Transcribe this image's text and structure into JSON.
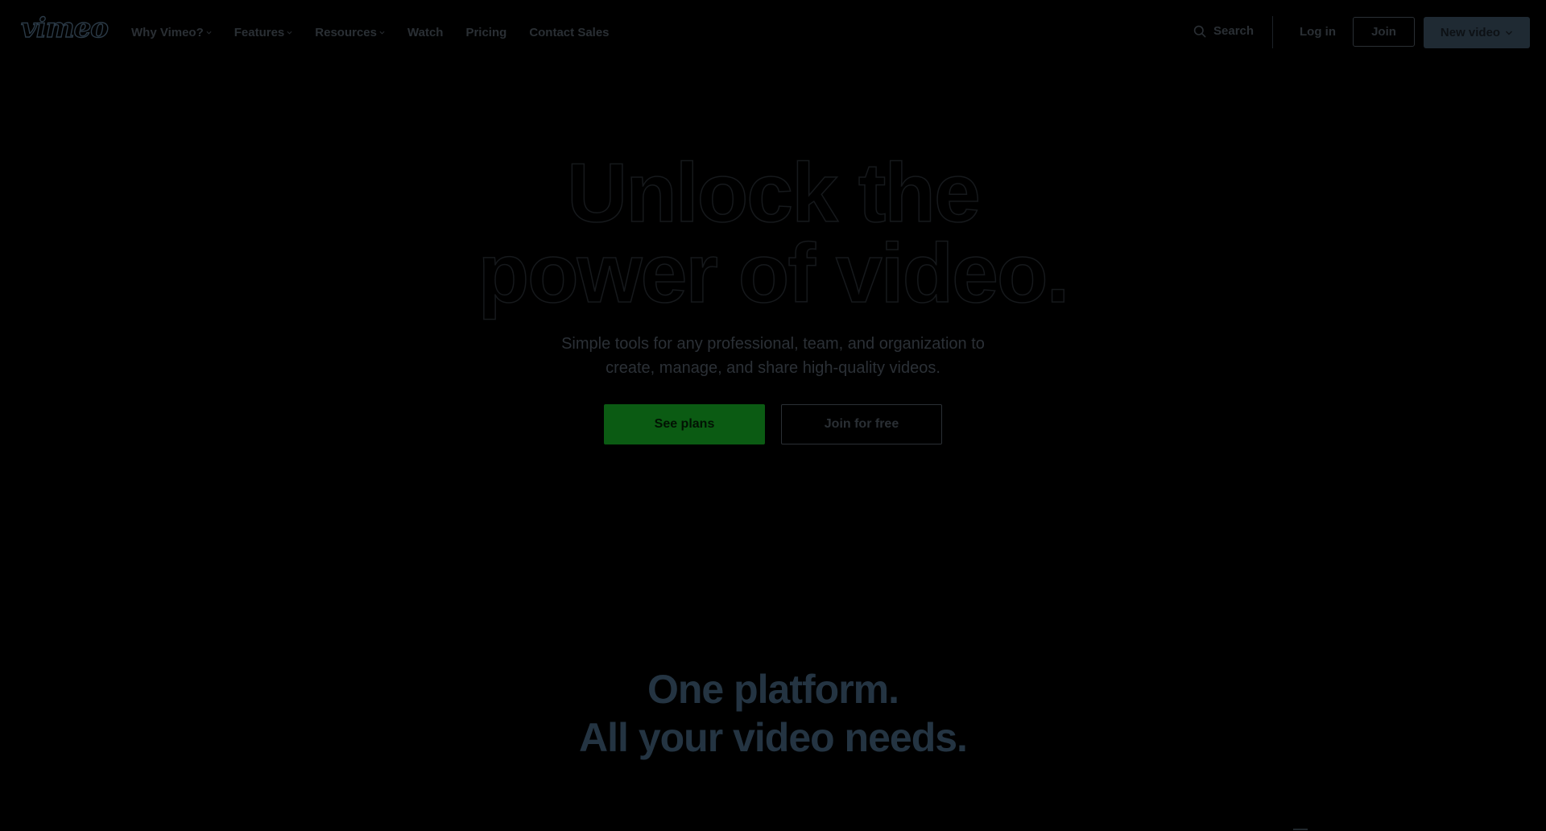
{
  "header": {
    "logo": "vimeo",
    "nav": [
      {
        "label": "Why Vimeo?",
        "has_dropdown": true
      },
      {
        "label": "Features",
        "has_dropdown": true
      },
      {
        "label": "Resources",
        "has_dropdown": true
      },
      {
        "label": "Watch",
        "has_dropdown": false
      },
      {
        "label": "Pricing",
        "has_dropdown": false
      },
      {
        "label": "Contact Sales",
        "has_dropdown": false
      }
    ],
    "search_label": "Search",
    "search_icon": "search-icon",
    "login_label": "Log in",
    "join_label": "Join",
    "new_video_label": "New video"
  },
  "hero": {
    "title_line1": "Unlock the",
    "title_line2": "power of video.",
    "subtitle_line1": "Simple tools for any professional, team, and organization to",
    "subtitle_line2": "create, manage, and share high-quality videos.",
    "primary_button": "See plans",
    "secondary_button": "Join for free"
  },
  "section": {
    "title_line1": "One platform.",
    "title_line2": "All your video needs."
  },
  "colors": {
    "background": "#000000",
    "primary_button": "#0b5b13",
    "new_video_button": "#1f2a33",
    "section_title": "#243442"
  }
}
